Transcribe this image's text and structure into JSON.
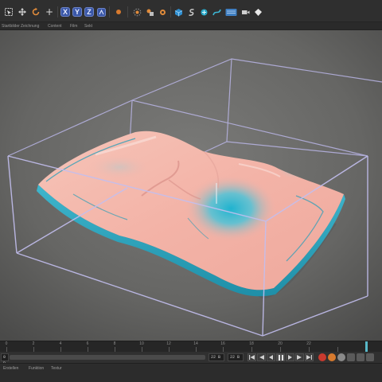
{
  "toolbar": {
    "tools": [
      {
        "name": "select-icon",
        "glyph": "⬚"
      },
      {
        "name": "move-icon",
        "glyph": "✥"
      },
      {
        "name": "rotate-icon",
        "glyph": "↻"
      },
      {
        "name": "scale-icon",
        "glyph": "+"
      }
    ],
    "axis_x": "X",
    "axis_y": "Y",
    "axis_z": "Z",
    "accent_color": "#3a57a8"
  },
  "menubar": {
    "items": [
      "Startbilder",
      "Zeichnung",
      "Content",
      "Film",
      "Sekt"
    ]
  },
  "viewport": {
    "surface_color": "#f4b3a8",
    "highlight_color": "#26b6cf",
    "cage_color": "#b9b5e6"
  },
  "timeline": {
    "ticks": [
      "0",
      "2",
      "4",
      "6",
      "8",
      "10",
      "12",
      "14",
      "16",
      "18",
      "20",
      "22"
    ]
  },
  "transport": {
    "start_frame": "0 B",
    "current_frame": "22 B",
    "end_frame": "22 B"
  },
  "bottom_panel": {
    "tabs": [
      "Erstellen",
      "Funktion",
      "Textur"
    ]
  }
}
